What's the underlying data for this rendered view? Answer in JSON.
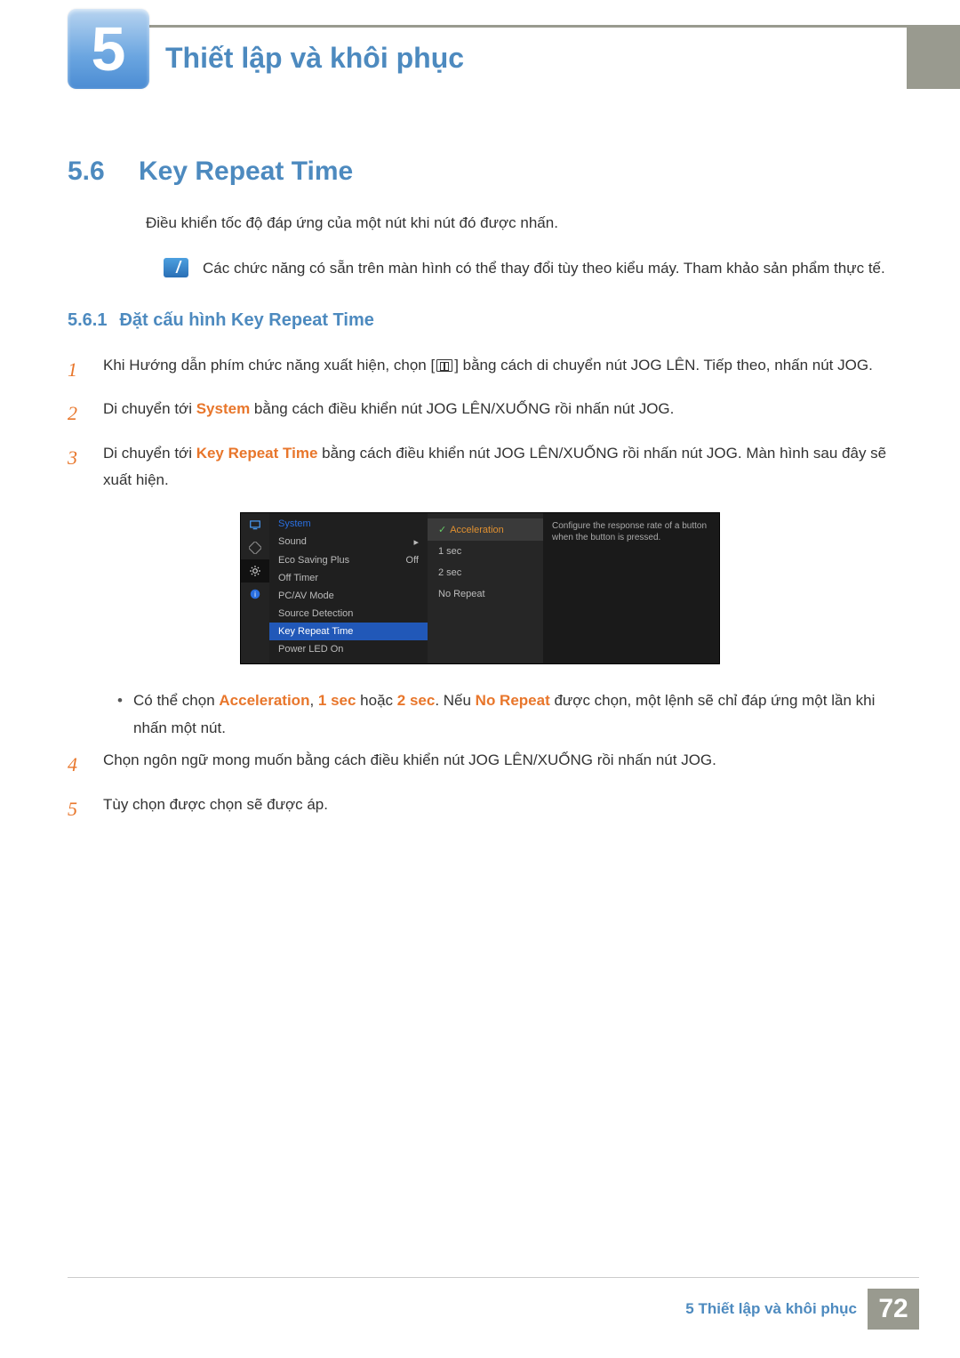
{
  "chapter": {
    "number": "5",
    "title": "Thiết lập và khôi phục"
  },
  "section": {
    "number": "5.6",
    "title": "Key Repeat Time",
    "intro": "Điều khiển tốc độ đáp ứng của một nút khi nút đó được nhấn.",
    "note": "Các chức năng có sẵn trên màn hình có thể thay đổi tùy theo kiểu máy. Tham khảo sản phẩm thực tế."
  },
  "subsection": {
    "number": "5.6.1",
    "title": "Đặt cấu hình Key Repeat Time"
  },
  "steps": {
    "n1": "1",
    "s1a": "Khi Hướng dẫn phím chức năng xuất hiện, chọn [",
    "s1b": "] bằng cách di chuyển nút JOG LÊN. Tiếp theo, nhấn nút JOG.",
    "n2": "2",
    "s2a": "Di chuyển tới ",
    "s2_system": "System",
    "s2b": " bằng cách điều khiển nút JOG LÊN/XUỐNG rồi nhấn nút JOG.",
    "n3": "3",
    "s3a": "Di chuyển tới ",
    "s3_key": "Key Repeat Time",
    "s3b": " bằng cách điều khiển nút JOG LÊN/XUỐNG rồi nhấn nút JOG. Màn hình sau đây sẽ xuất hiện.",
    "n4": "4",
    "s4": "Chọn ngôn ngữ mong muốn bằng cách điều khiển nút JOG LÊN/XUỐNG rồi nhấn nút JOG.",
    "n5": "5",
    "s5": "Tùy chọn được chọn sẽ được áp."
  },
  "bullet": {
    "a": "Có thể chọn ",
    "accel": "Acceleration",
    "comma1": ", ",
    "one": "1 sec",
    "or": " hoặc ",
    "two": "2 sec",
    "dot": ". Nếu ",
    "norep": "No Repeat",
    "b": " được chọn, một lệnh sẽ chỉ đáp ứng một lần khi nhấn một nút."
  },
  "osd": {
    "menu_title": "System",
    "rows": {
      "sound": "Sound",
      "eco": "Eco Saving Plus",
      "eco_val": "Off",
      "offtimer": "Off Timer",
      "pcav": "PC/AV Mode",
      "source": "Source Detection",
      "keyrep": "Key Repeat Time",
      "power": "Power LED On"
    },
    "arrow": "▸",
    "sub": {
      "accel": "Acceleration",
      "s1": "1 sec",
      "s2": "2 sec",
      "nr": "No Repeat"
    },
    "desc": "Configure the response rate of a button when the button is pressed."
  },
  "footer": {
    "text": "5 Thiết lập và khôi phục",
    "page": "72"
  }
}
